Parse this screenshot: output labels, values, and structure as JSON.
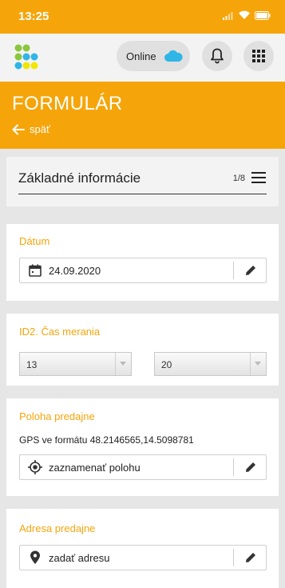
{
  "status_bar": {
    "time": "13:25"
  },
  "header": {
    "status_label": "Online"
  },
  "form": {
    "title": "FORMULÁR",
    "back_label": "späť"
  },
  "section": {
    "title": "Základné informácie",
    "counter": "1/8"
  },
  "date_card": {
    "label": "Dátum",
    "value": "24.09.2020"
  },
  "time_card": {
    "label": "ID2. Čas merania",
    "hour": "13",
    "minute": "20"
  },
  "location_card": {
    "label": "Poloha predajne",
    "gps_text": "GPS ve formátu 48.2146565,14.5098781",
    "action": "zaznamenať polohu"
  },
  "address_card": {
    "label": "Adresa predajne",
    "action": "zadať adresu"
  },
  "colors": {
    "accent": "#f5a50a",
    "cloud": "#2fb5e6",
    "logo_green": "#8cc63f",
    "logo_blue": "#2fb5e6",
    "logo_yellow": "#f2e600"
  }
}
